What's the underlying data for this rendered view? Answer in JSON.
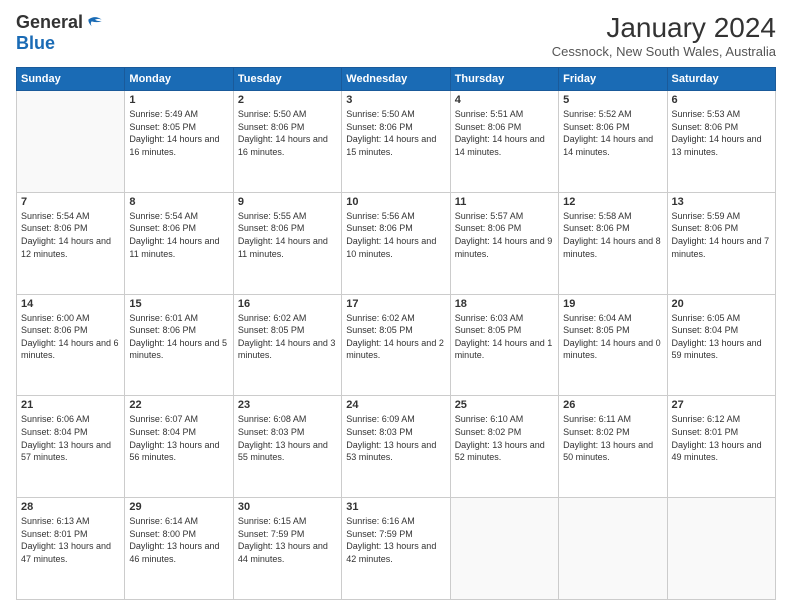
{
  "header": {
    "logo_general": "General",
    "logo_blue": "Blue",
    "month_title": "January 2024",
    "location": "Cessnock, New South Wales, Australia"
  },
  "weekdays": [
    "Sunday",
    "Monday",
    "Tuesday",
    "Wednesday",
    "Thursday",
    "Friday",
    "Saturday"
  ],
  "weeks": [
    [
      {
        "day": "",
        "empty": true
      },
      {
        "day": "1",
        "sunrise": "5:49 AM",
        "sunset": "8:05 PM",
        "daylight": "14 hours and 16 minutes."
      },
      {
        "day": "2",
        "sunrise": "5:50 AM",
        "sunset": "8:06 PM",
        "daylight": "14 hours and 16 minutes."
      },
      {
        "day": "3",
        "sunrise": "5:50 AM",
        "sunset": "8:06 PM",
        "daylight": "14 hours and 15 minutes."
      },
      {
        "day": "4",
        "sunrise": "5:51 AM",
        "sunset": "8:06 PM",
        "daylight": "14 hours and 14 minutes."
      },
      {
        "day": "5",
        "sunrise": "5:52 AM",
        "sunset": "8:06 PM",
        "daylight": "14 hours and 14 minutes."
      },
      {
        "day": "6",
        "sunrise": "5:53 AM",
        "sunset": "8:06 PM",
        "daylight": "14 hours and 13 minutes."
      }
    ],
    [
      {
        "day": "7",
        "sunrise": "5:54 AM",
        "sunset": "8:06 PM",
        "daylight": "14 hours and 12 minutes."
      },
      {
        "day": "8",
        "sunrise": "5:54 AM",
        "sunset": "8:06 PM",
        "daylight": "14 hours and 11 minutes."
      },
      {
        "day": "9",
        "sunrise": "5:55 AM",
        "sunset": "8:06 PM",
        "daylight": "14 hours and 11 minutes."
      },
      {
        "day": "10",
        "sunrise": "5:56 AM",
        "sunset": "8:06 PM",
        "daylight": "14 hours and 10 minutes."
      },
      {
        "day": "11",
        "sunrise": "5:57 AM",
        "sunset": "8:06 PM",
        "daylight": "14 hours and 9 minutes."
      },
      {
        "day": "12",
        "sunrise": "5:58 AM",
        "sunset": "8:06 PM",
        "daylight": "14 hours and 8 minutes."
      },
      {
        "day": "13",
        "sunrise": "5:59 AM",
        "sunset": "8:06 PM",
        "daylight": "14 hours and 7 minutes."
      }
    ],
    [
      {
        "day": "14",
        "sunrise": "6:00 AM",
        "sunset": "8:06 PM",
        "daylight": "14 hours and 6 minutes."
      },
      {
        "day": "15",
        "sunrise": "6:01 AM",
        "sunset": "8:06 PM",
        "daylight": "14 hours and 5 minutes."
      },
      {
        "day": "16",
        "sunrise": "6:02 AM",
        "sunset": "8:05 PM",
        "daylight": "14 hours and 3 minutes."
      },
      {
        "day": "17",
        "sunrise": "6:02 AM",
        "sunset": "8:05 PM",
        "daylight": "14 hours and 2 minutes."
      },
      {
        "day": "18",
        "sunrise": "6:03 AM",
        "sunset": "8:05 PM",
        "daylight": "14 hours and 1 minute."
      },
      {
        "day": "19",
        "sunrise": "6:04 AM",
        "sunset": "8:05 PM",
        "daylight": "14 hours and 0 minutes."
      },
      {
        "day": "20",
        "sunrise": "6:05 AM",
        "sunset": "8:04 PM",
        "daylight": "13 hours and 59 minutes."
      }
    ],
    [
      {
        "day": "21",
        "sunrise": "6:06 AM",
        "sunset": "8:04 PM",
        "daylight": "13 hours and 57 minutes."
      },
      {
        "day": "22",
        "sunrise": "6:07 AM",
        "sunset": "8:04 PM",
        "daylight": "13 hours and 56 minutes."
      },
      {
        "day": "23",
        "sunrise": "6:08 AM",
        "sunset": "8:03 PM",
        "daylight": "13 hours and 55 minutes."
      },
      {
        "day": "24",
        "sunrise": "6:09 AM",
        "sunset": "8:03 PM",
        "daylight": "13 hours and 53 minutes."
      },
      {
        "day": "25",
        "sunrise": "6:10 AM",
        "sunset": "8:02 PM",
        "daylight": "13 hours and 52 minutes."
      },
      {
        "day": "26",
        "sunrise": "6:11 AM",
        "sunset": "8:02 PM",
        "daylight": "13 hours and 50 minutes."
      },
      {
        "day": "27",
        "sunrise": "6:12 AM",
        "sunset": "8:01 PM",
        "daylight": "13 hours and 49 minutes."
      }
    ],
    [
      {
        "day": "28",
        "sunrise": "6:13 AM",
        "sunset": "8:01 PM",
        "daylight": "13 hours and 47 minutes."
      },
      {
        "day": "29",
        "sunrise": "6:14 AM",
        "sunset": "8:00 PM",
        "daylight": "13 hours and 46 minutes."
      },
      {
        "day": "30",
        "sunrise": "6:15 AM",
        "sunset": "7:59 PM",
        "daylight": "13 hours and 44 minutes."
      },
      {
        "day": "31",
        "sunrise": "6:16 AM",
        "sunset": "7:59 PM",
        "daylight": "13 hours and 42 minutes."
      },
      {
        "day": "",
        "empty": true
      },
      {
        "day": "",
        "empty": true
      },
      {
        "day": "",
        "empty": true
      }
    ]
  ]
}
